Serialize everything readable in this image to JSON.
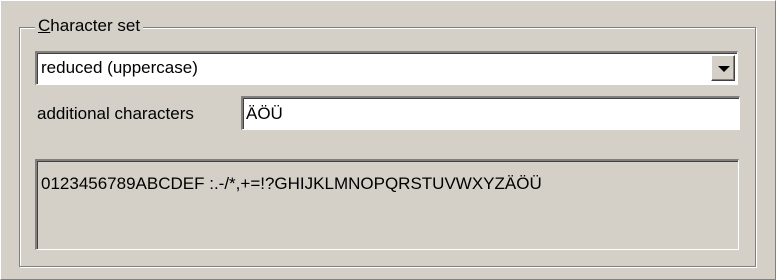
{
  "group": {
    "title_mnemonic": "C",
    "title_rest": "haracter set"
  },
  "charset_select": {
    "value": "reduced  (uppercase)",
    "dropdown_icon": "chevron-down-icon"
  },
  "additional_characters": {
    "label": "additional characters",
    "value": "ÄÖÜ"
  },
  "character_preview": {
    "text": "0123456789ABCDEF :.-/*,+=!?GHIJKLMNOPQRSTUVWXYZÄÖÜ"
  }
}
